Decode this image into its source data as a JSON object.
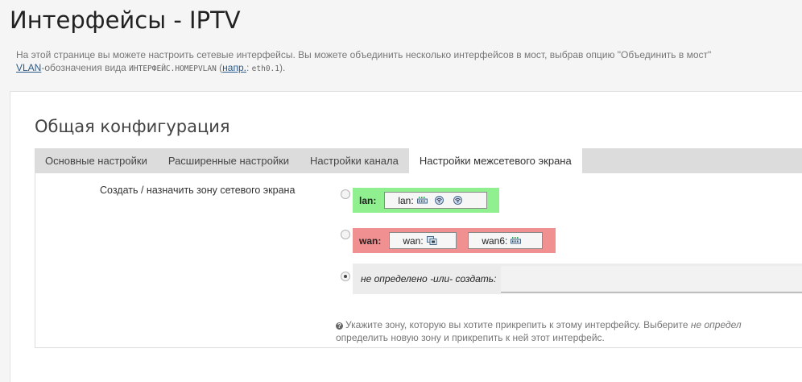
{
  "page": {
    "title": "Интерфейсы - IPTV",
    "description_line1": "На этой странице вы можете настроить сетевые интерфейсы. Вы можете объединить несколько интерфейсов в мост, выбрав опцию \"Объединить в мост\"",
    "description_vlan_link": "VLAN",
    "description_line2_a": "-обозначения вида ",
    "description_code1": "ИНТЕРФЕЙС.HOMEPVLAN",
    "description_line2_b": " (",
    "description_example_link": "напр.",
    "description_line2_c": ": ",
    "description_code2": "eth0.1",
    "description_line2_d": ")."
  },
  "section": {
    "title": "Общая конфигурация",
    "tabs": [
      {
        "label": "Основные настройки",
        "active": false
      },
      {
        "label": "Расширенные настройки",
        "active": false
      },
      {
        "label": "Настройки канала",
        "active": false
      },
      {
        "label": "Настройки межсетевого экрана",
        "active": true
      }
    ]
  },
  "firewall": {
    "field_label": "Создать / назначить зону сетевого экрана",
    "zones": [
      {
        "name": "lan:",
        "color": "#90f090",
        "selected": false,
        "networks": [
          {
            "label": "lan:",
            "icons": [
              "ethernet-switch-icon",
              "wifi-icon",
              "wifi-icon"
            ]
          }
        ]
      },
      {
        "name": "wan:",
        "color": "#f09090",
        "selected": false,
        "networks": [
          {
            "label": "wan:",
            "icons": [
              "ethernet-port-icon"
            ]
          },
          {
            "label": "wan6:",
            "icons": [
              "ethernet-switch-icon"
            ]
          }
        ]
      }
    ],
    "unspecified": {
      "label": "не определено -или- создать:",
      "value": "",
      "selected": true
    },
    "help_line1_a": "Укажите зону, которую вы хотите прикрепить к этому интерфейсу. Выберите ",
    "help_line1_em": "не определ",
    "help_line2": "определить новую зону и прикрепить к ней этот интерфейс."
  },
  "colors": {
    "lan_zone": "#90f090",
    "wan_zone": "#f09090",
    "tab_bar": "#dcdcdc",
    "link": "#2a5b8a"
  }
}
